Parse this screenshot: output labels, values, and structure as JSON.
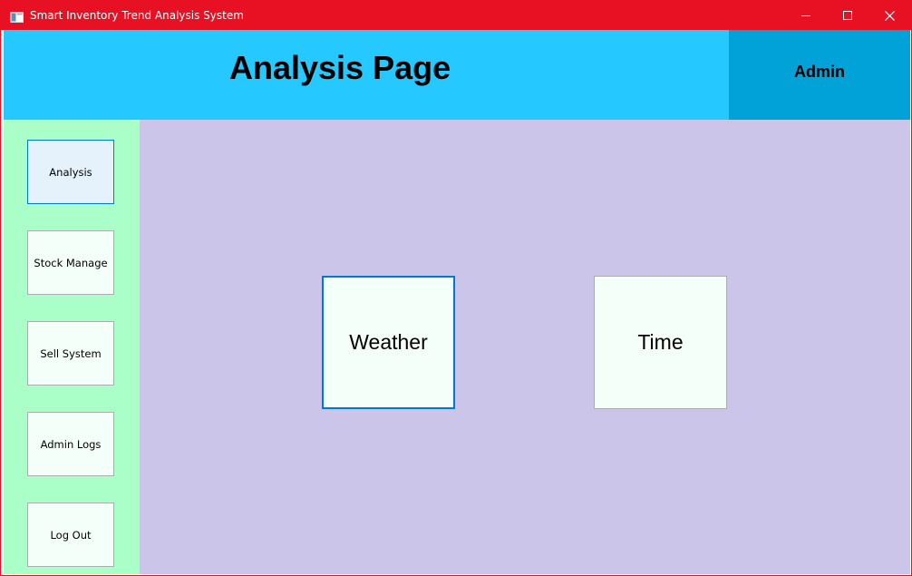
{
  "window": {
    "title": "Smart Inventory Trend Analysis System",
    "accent_color": "#e81123",
    "icon": "app-window-icon",
    "controls": [
      "minimize-icon",
      "maximize-icon",
      "close-icon"
    ]
  },
  "header": {
    "title": "Analysis Page",
    "user": "Admin",
    "colors": {
      "header_bg": "#25c9ff",
      "user_bg": "#00a2d8"
    }
  },
  "sidebar": {
    "background": "#aaffc8",
    "items": [
      {
        "label": "Analysis",
        "active": true
      },
      {
        "label": "Stock Manage",
        "active": false
      },
      {
        "label": "Sell System",
        "active": false
      },
      {
        "label": "Admin Logs",
        "active": false
      },
      {
        "label": "Log Out",
        "active": false
      }
    ]
  },
  "main": {
    "background": "#cbc5e9",
    "tiles": [
      {
        "label": "Weather",
        "focused": true
      },
      {
        "label": "Time",
        "focused": false
      }
    ]
  }
}
